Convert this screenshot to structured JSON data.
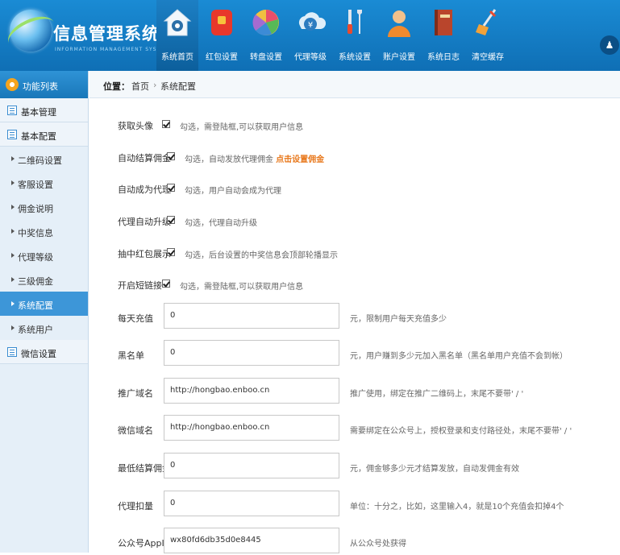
{
  "header": {
    "title": "信息管理系统界面",
    "subtitle": "INFORMATION MANAGEMENT SYSTEM GUI",
    "nav": [
      {
        "label": "系统首页",
        "icon": "home-icon"
      },
      {
        "label": "红包设置",
        "icon": "red-packet-icon"
      },
      {
        "label": "转盘设置",
        "icon": "wheel-icon"
      },
      {
        "label": "代理等级",
        "icon": "money-icon"
      },
      {
        "label": "系统设置",
        "icon": "tools-icon"
      },
      {
        "label": "账户设置",
        "icon": "user-icon"
      },
      {
        "label": "系统日志",
        "icon": "log-book-icon"
      },
      {
        "label": "清空缓存",
        "icon": "broom-icon"
      }
    ],
    "user_glyph": "♟"
  },
  "sidebar": {
    "title": "功能列表",
    "group1": "基本管理",
    "group2": "基本配置",
    "items": [
      {
        "label": "二维码设置"
      },
      {
        "label": "客服设置"
      },
      {
        "label": "佣金说明"
      },
      {
        "label": "中奖信息"
      },
      {
        "label": "代理等级"
      },
      {
        "label": "三级佣金"
      },
      {
        "label": "系统配置"
      },
      {
        "label": "系统用户"
      }
    ],
    "group3": "微信设置"
  },
  "breadcrumb": {
    "label": "位置：",
    "home": "首页",
    "sep": "›",
    "current": "系统配置"
  },
  "form": {
    "checks": [
      {
        "label": "获取头像",
        "hint": "勾选，需登陆框,可以获取用户信息"
      },
      {
        "label": "自动结算佣金",
        "hint": "勾选，自动发放代理佣金 ",
        "link": "点击设置佣金"
      },
      {
        "label": "自动成为代理",
        "hint": "勾选，用户自动会成为代理"
      },
      {
        "label": "代理自动升级",
        "hint": "勾选，代理自动升级"
      },
      {
        "label": "抽中红包展示",
        "hint": "勾选，后台设置的中奖信息会顶部轮播显示"
      },
      {
        "label": "开启短链接",
        "hint": "勾选，需登陆框,可以获取用户信息"
      }
    ],
    "fields": [
      {
        "label": "每天充值",
        "value": "0",
        "hint": "元，限制用户每天充值多少"
      },
      {
        "label": "黑名单",
        "value": "0",
        "hint": "元，用户赚到多少元加入黑名单（黑名单用户充值不会到帐）"
      },
      {
        "label": "推广域名",
        "value": "http://hongbao.enboo.cn",
        "hint": "推广使用，绑定在推广二维码上，末尾不要带' / '"
      },
      {
        "label": "微信域名",
        "value": "http://hongbao.enboo.cn",
        "hint": "需要绑定在公众号上，授权登录和支付路径处，末尾不要带' / '"
      },
      {
        "label": "最低结算佣金",
        "value": "0",
        "hint": "元，佣金够多少元才结算发放，自动发佣金有效"
      },
      {
        "label": "代理扣量",
        "value": "0",
        "hint": "单位：十分之，比如，这里输入4，就是10个充值会扣掉4个"
      },
      {
        "label": "公众号AppId",
        "value": "wx80fd6db35d0e8445",
        "hint": "从公众号处获得"
      }
    ]
  }
}
